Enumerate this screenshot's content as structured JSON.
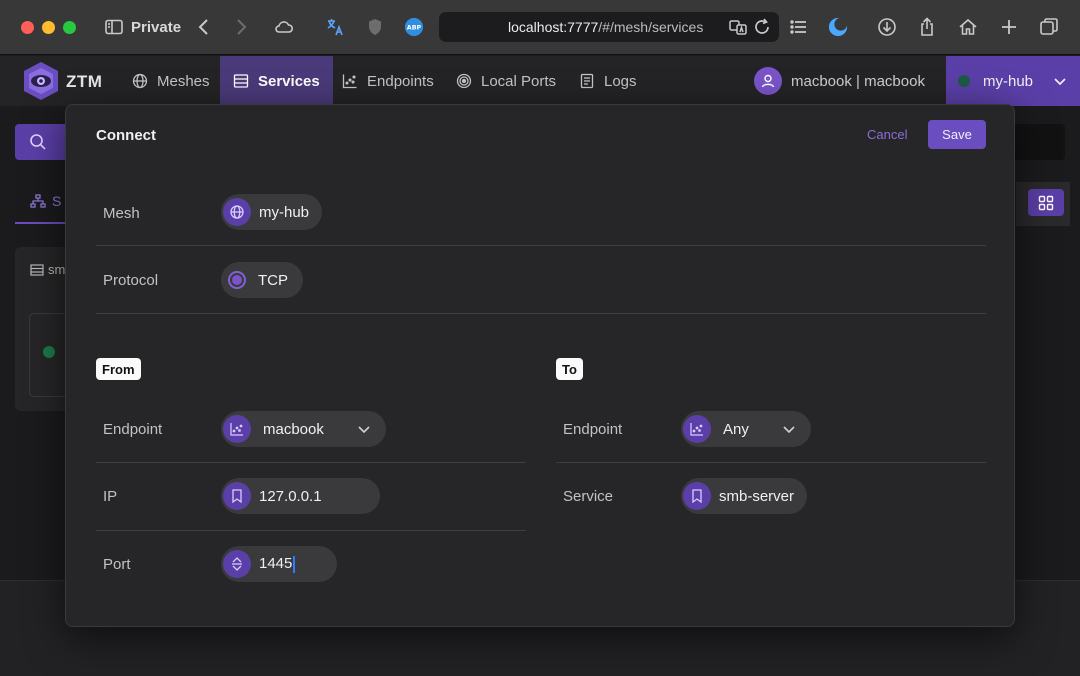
{
  "browser": {
    "private_label": "Private",
    "url_host": "localhost:7777",
    "url_path": "/#/mesh/services"
  },
  "app": {
    "logo_text": "ZTM",
    "nav": [
      {
        "label": "Meshes",
        "icon": "globe-icon"
      },
      {
        "label": "Services",
        "icon": "list-icon",
        "active": true
      },
      {
        "label": "Endpoints",
        "icon": "scatter-icon"
      },
      {
        "label": "Local Ports",
        "icon": "target-icon"
      },
      {
        "label": "Logs",
        "icon": "document-icon"
      }
    ],
    "user_label": "macbook | macbook",
    "hub_label": "my-hub"
  },
  "background": {
    "tab_label": "S",
    "card_label": "sm"
  },
  "modal": {
    "title": "Connect",
    "cancel_label": "Cancel",
    "save_label": "Save",
    "mesh_label": "Mesh",
    "mesh_value": "my-hub",
    "protocol_label": "Protocol",
    "protocol_value": "TCP",
    "from": {
      "heading": "From",
      "endpoint_label": "Endpoint",
      "endpoint_value": "macbook",
      "ip_label": "IP",
      "ip_value": "127.0.0.1",
      "port_label": "Port",
      "port_value": "1445"
    },
    "to": {
      "heading": "To",
      "endpoint_label": "Endpoint",
      "endpoint_value": "Any",
      "service_label": "Service",
      "service_value": "smb-server"
    }
  },
  "colors": {
    "accent": "#6a4ec0",
    "accent_dark": "#5b3fa8",
    "panel": "#262628"
  }
}
